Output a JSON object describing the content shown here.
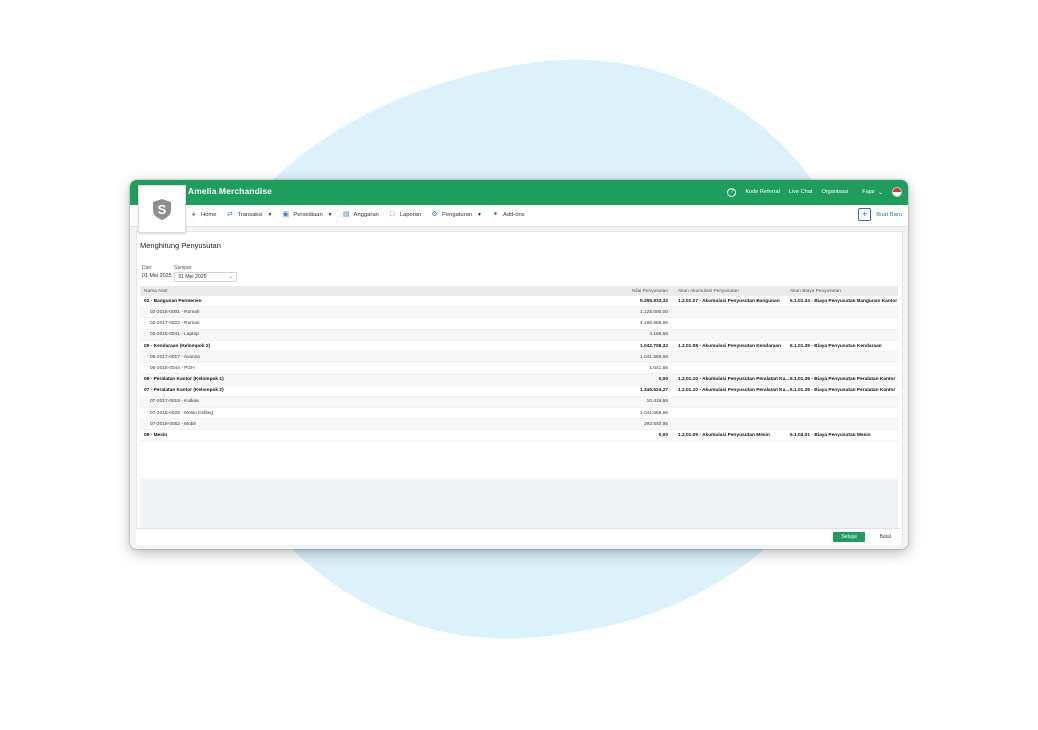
{
  "app": {
    "title": "Amelia Merchandise",
    "colors": {
      "brand_green": "#1e9e5c",
      "link_blue": "#2f6bd1",
      "background_blob": "#dbf2fa"
    }
  },
  "topbar": {
    "help_icon": "question-circle-icon",
    "kode_referral": "Kode Referral",
    "live_chat": "Live Chat",
    "organisasi": "Organisasi",
    "user": "Fajar",
    "flag_icon": "indonesia-flag-icon"
  },
  "logo": {
    "letter": "S",
    "icon": "shield-logo-icon"
  },
  "nav": {
    "items": [
      {
        "label": "Home",
        "icon": "dashboard-icon",
        "has_caret": false
      },
      {
        "label": "Transaksi",
        "icon": "exchange-icon",
        "has_caret": true
      },
      {
        "label": "Persediaan",
        "icon": "box-icon",
        "has_caret": true
      },
      {
        "label": "Anggaran",
        "icon": "budget-icon",
        "has_caret": false
      },
      {
        "label": "Laporan",
        "icon": "report-icon",
        "has_caret": false
      },
      {
        "label": "Pengaturan",
        "icon": "gear-icon",
        "has_caret": true
      },
      {
        "label": "Add-ons",
        "icon": "puzzle-icon",
        "has_caret": false
      }
    ],
    "new_button": "Buat Baru"
  },
  "page": {
    "title": "Menghitung Penyusutan",
    "filter": {
      "dari_label": "Dari:",
      "dari_value": "01 Mei 2025",
      "sampai_label": "Sampai:",
      "sampai_value": "31 Mei 2025"
    }
  },
  "table": {
    "headers": {
      "name": "Nama Aset",
      "value": "Nilai Penyusutan",
      "acc_accum": "Akun Akumulasi Penyusutan",
      "acc_expense": "Akun Biaya Penyusutan"
    },
    "rows": [
      {
        "name": "02 - Bangunan Permenen",
        "value": "5.295.833,32",
        "acc_accum": "1.2.01.07 - Akumulasi Penyusutan Bangunan",
        "acc_expense": "6.1.01.34 - Biaya Penyusutan Bangunan Kantor",
        "group": true
      },
      {
        "name": "02-2015-0001 - Rumah",
        "value": "1.125.000,00",
        "acc_accum": "",
        "acc_expense": "",
        "group": false
      },
      {
        "name": "02-2017-0022 - Ruman",
        "value": "4.166.666,66",
        "acc_accum": "",
        "acc_expense": "",
        "group": false
      },
      {
        "name": "02-2018-0041 - Laptop",
        "value": "4.166,66",
        "acc_accum": "",
        "acc_expense": "",
        "group": false
      },
      {
        "name": "05 - Kendaraan (Kelompok 2)",
        "value": "1.042.708,32",
        "acc_accum": "1.2.01.08 - Akumulasi Penyusutan Kendaraan",
        "acc_expense": "6.1.01.35 - Biaya Penyusutan Kendaraan",
        "group": true
      },
      {
        "name": "05-2017-0017 - Avanza",
        "value": "1.041.666,66",
        "acc_accum": "",
        "acc_expense": "",
        "group": false
      },
      {
        "name": "05-2018-0044 - PGH",
        "value": "1.041,66",
        "acc_accum": "",
        "acc_expense": "",
        "group": false
      },
      {
        "name": "06 - Peralatan Kantor (Kelompok 1)",
        "value": "0,00",
        "acc_accum": "1.2.01.10 - Akumulasi Penyusutan Peralatan Ka...",
        "acc_expense": "6.1.01.36 - Biaya Penyusutan Peralatan Kantor",
        "group": true
      },
      {
        "name": "07 - Peralatan Kantor (Kelompok 2)",
        "value": "1.345.624,27",
        "acc_accum": "1.2.01.10 - Akumulasi Penyusutan Peralatan Ka...",
        "acc_expense": "6.1.01.36 - Biaya Penyusutan Peralatan Kantor",
        "group": true
      },
      {
        "name": "07-2017-0018 - Kulkas",
        "value": "10.416,66",
        "acc_accum": "",
        "acc_expense": "",
        "group": false
      },
      {
        "name": "07-2018-0025 - Mesin Drilling",
        "value": "1.041.666,66",
        "acc_accum": "",
        "acc_expense": "",
        "group": false
      },
      {
        "name": "07-2018-0052 - Mobil",
        "value": "293.540,95",
        "acc_accum": "",
        "acc_expense": "",
        "group": false
      },
      {
        "name": "09 - Mesin",
        "value": "0,00",
        "acc_accum": "1.2.01.09 - Akumulasi Penyusutan Mesin",
        "acc_expense": "6.1.04.01 - Biaya Penyusutan Mesin",
        "group": true
      }
    ]
  },
  "footer": {
    "save_label": "Setujui",
    "cancel_label": "Batal"
  }
}
